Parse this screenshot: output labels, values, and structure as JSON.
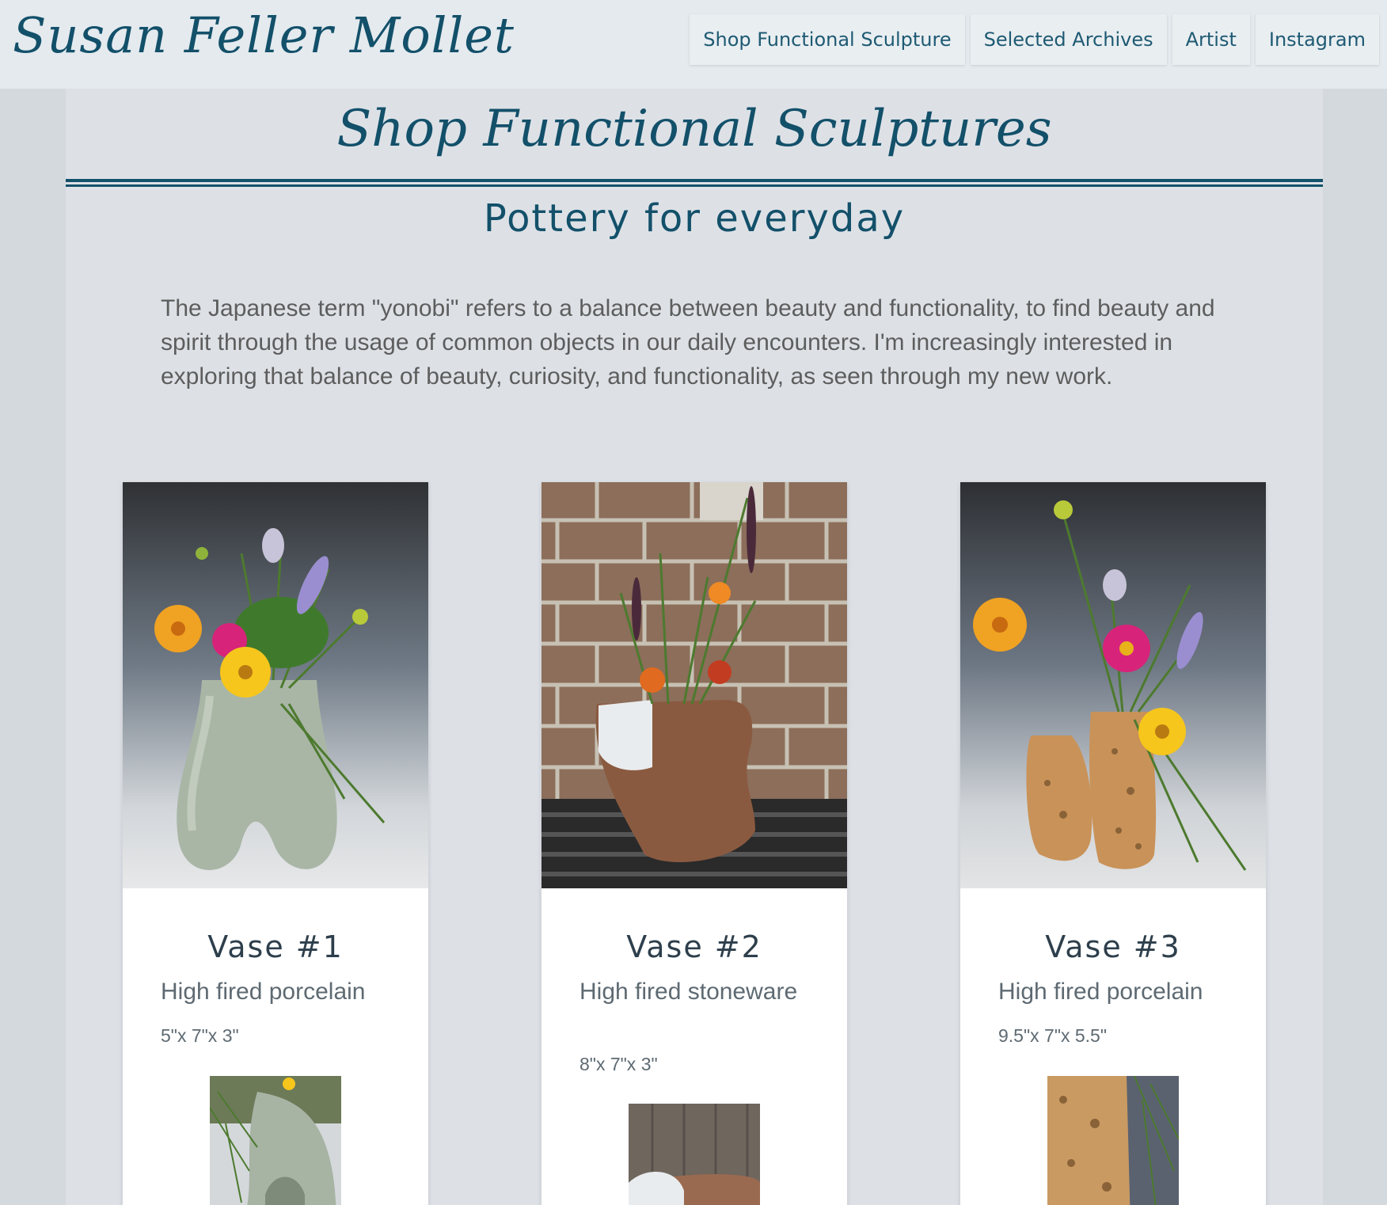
{
  "header": {
    "site_title": "Susan Feller Mollet",
    "nav": [
      {
        "label": "Shop Functional Sculpture"
      },
      {
        "label": "Selected Archives"
      },
      {
        "label": "Artist"
      },
      {
        "label": "Instagram"
      }
    ]
  },
  "page": {
    "title": "Shop Functional Sculptures",
    "subtitle": "Pottery for everyday",
    "intro": "The Japanese term \"yonobi\" refers to a balance between beauty and functionality, to find beauty and spirit through the usage of common objects in our daily encounters. I'm increasingly interested in exploring that balance of beauty, curiosity, and functionality, as seen through my new work."
  },
  "products": [
    {
      "name": "Vase #1",
      "material": "High fired porcelain",
      "dimensions": "5\"x 7\"x 3\""
    },
    {
      "name": "Vase #2",
      "material": "High fired stoneware",
      "dimensions": "8\"x 7\"x 3\""
    },
    {
      "name": "Vase #3",
      "material": "High fired porcelain",
      "dimensions": "9.5\"x 7\"x 5.5\""
    }
  ],
  "colors": {
    "brand": "#13506a",
    "header_bg": "#e4eaee",
    "page_bg": "#d4d9de",
    "content_bg": "#dde1e6",
    "card_bg": "#ffffff"
  }
}
